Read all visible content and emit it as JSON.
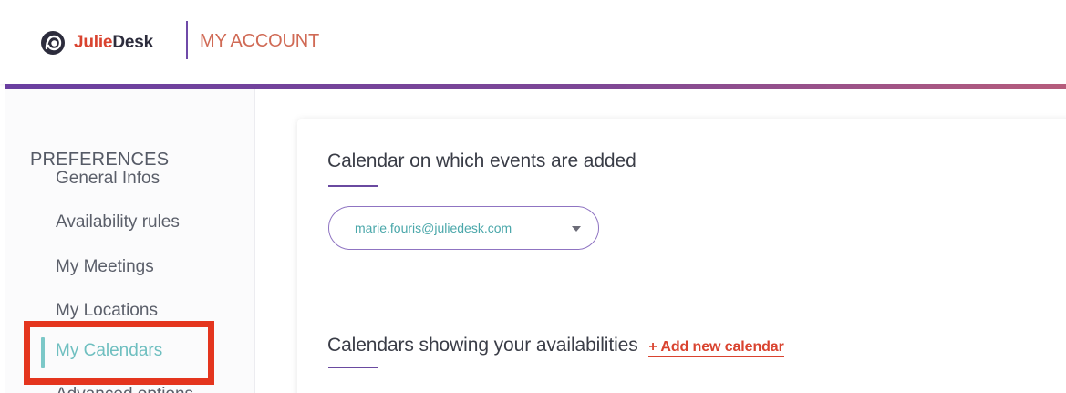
{
  "header": {
    "logo_icon": "julie-avatar-icon",
    "brand_part1": "Julie",
    "brand_part2": "Desk",
    "section_title": "MY ACCOUNT"
  },
  "sidebar": {
    "heading": "PREFERENCES",
    "items": [
      {
        "label": "General Infos"
      },
      {
        "label": "Availability rules"
      },
      {
        "label": "My Meetings"
      },
      {
        "label": "My Locations"
      },
      {
        "label": "My Calendars",
        "active": true
      },
      {
        "label": "Advanced options"
      }
    ]
  },
  "main": {
    "section1_title": "Calendar on which events are added",
    "calendar_select_value": "marie.fouris@juliedesk.com",
    "section2_title": "Calendars showing your availabilities",
    "add_calendar_label": "+ Add new calendar"
  },
  "colors": {
    "brand_red": "#d9432f",
    "accent_purple": "#6a3fa0",
    "teal_active": "#6fbfc0",
    "highlight_red": "#e4351e"
  }
}
